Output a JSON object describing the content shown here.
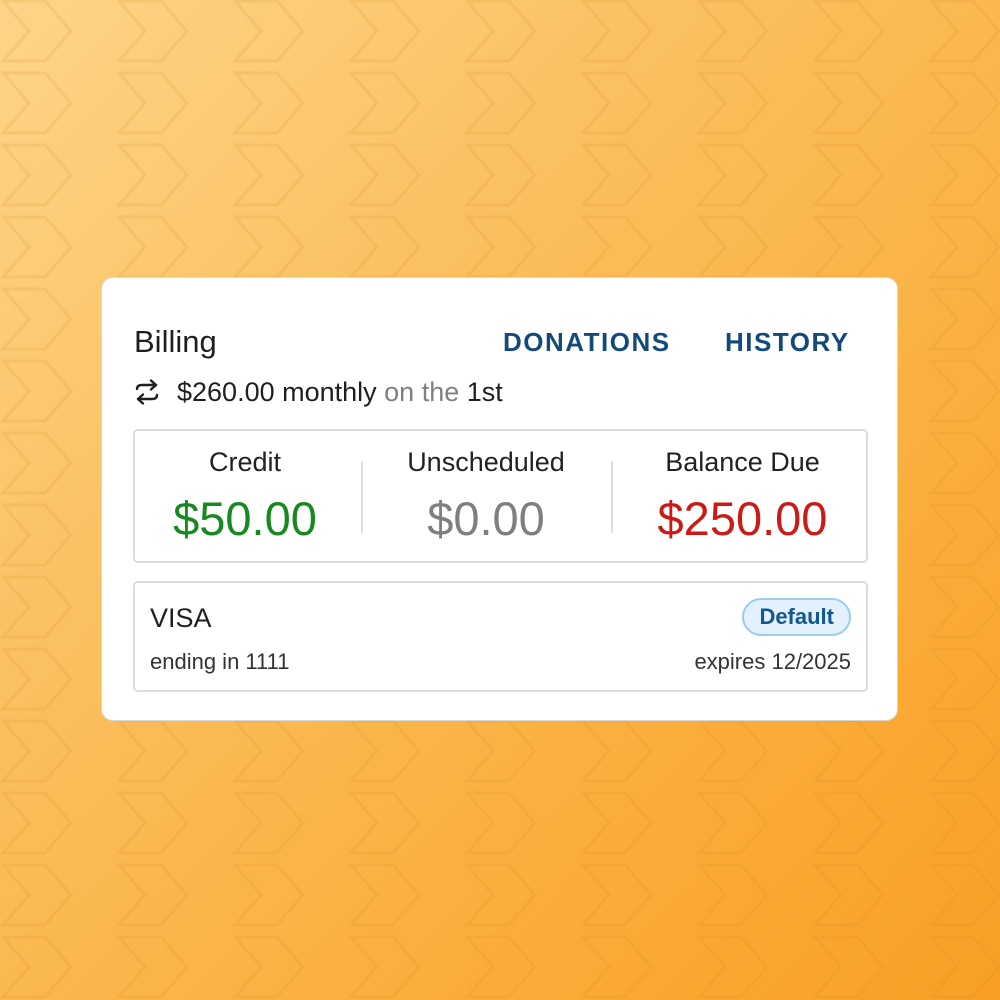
{
  "billing": {
    "title": "Billing",
    "nav": {
      "donations_label": "DONATIONS",
      "history_label": "HISTORY"
    },
    "schedule": {
      "icon": "repeat-icon",
      "amount_text": "$260.00 monthly",
      "connector_text": "on the",
      "day_text": "1st"
    },
    "summary": [
      {
        "label": "Credit",
        "value": "$50.00",
        "color": "#16891f"
      },
      {
        "label": "Unscheduled",
        "value": "$0.00",
        "color": "#7f7f7f"
      },
      {
        "label": "Balance Due",
        "value": "$250.00",
        "color": "#cc1a17"
      }
    ],
    "payment_method": {
      "brand": "VISA",
      "ending": "ending in 1111",
      "expires": "expires 12/2025",
      "badge": "Default"
    }
  },
  "colors": {
    "accent_link": "#134a7c",
    "credit": "#16891f",
    "unscheduled": "#7f7f7f",
    "balance_due": "#cc1a17",
    "badge_bg": "#e3f1fc",
    "badge_border": "#9ccbee",
    "background_gradient_start": "#fdd589",
    "background_gradient_end": "#f99f24"
  }
}
